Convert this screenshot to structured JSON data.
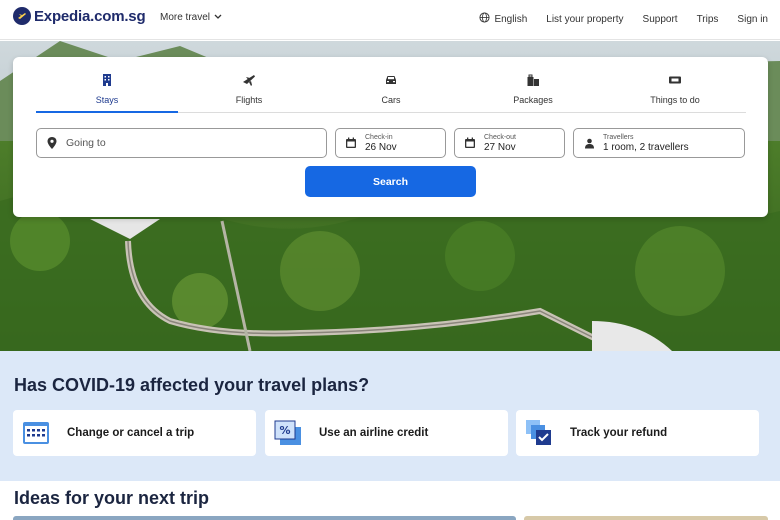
{
  "header": {
    "logo_text": "Expedia.com.sg",
    "more_travel": "More travel",
    "nav": {
      "language": "English",
      "list_property": "List your property",
      "support": "Support",
      "trips": "Trips",
      "sign_in": "Sign in"
    }
  },
  "search": {
    "tabs": [
      {
        "label": "Stays",
        "icon": "building-icon",
        "active": true
      },
      {
        "label": "Flights",
        "icon": "plane-icon",
        "active": false
      },
      {
        "label": "Cars",
        "icon": "car-icon",
        "active": false
      },
      {
        "label": "Packages",
        "icon": "packages-icon",
        "active": false
      },
      {
        "label": "Things to do",
        "icon": "ticket-icon",
        "active": false
      }
    ],
    "going_to": "Going to",
    "checkin_label": "Check-in",
    "checkin_value": "26 Nov",
    "checkout_label": "Check-out",
    "checkout_value": "27 Nov",
    "travellers_label": "Travellers",
    "travellers_value": "1 room, 2 travellers",
    "search_button": "Search"
  },
  "covid": {
    "title": "Has COVID-19 affected your travel plans?",
    "cards": [
      {
        "label": "Change or cancel a trip",
        "icon": "calendar-grid-icon"
      },
      {
        "label": "Use an airline credit",
        "icon": "percent-ticket-icon"
      },
      {
        "label": "Track your refund",
        "icon": "check-stack-icon"
      }
    ]
  },
  "ideas": {
    "title": "Ideas for your next trip"
  },
  "colors": {
    "brand_navy": "#1f2b6b",
    "primary_blue": "#1668e3",
    "covid_bg": "#dce8f8"
  }
}
